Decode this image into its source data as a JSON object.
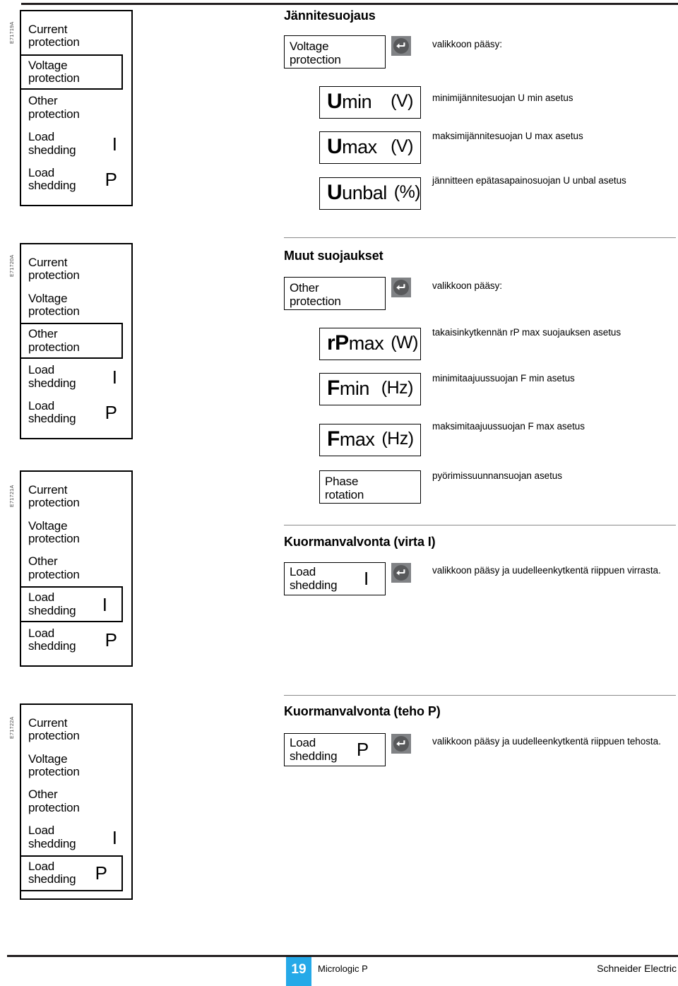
{
  "page": {
    "footer": {
      "page_number": "19",
      "document": "Micrologic P",
      "brand": "Schneider Electric",
      "accent_color": "#25a9e8"
    }
  },
  "menu_items": {
    "current_protection": "Current\nprotection",
    "voltage_protection": "Voltage\nprotection",
    "other_protection": "Other\nprotection",
    "load_shedding": "Load\nshedding",
    "sym_i": "I",
    "sym_p": "P"
  },
  "sections": [
    {
      "ref_code": "E71719A",
      "title": "Jännitesuojaus",
      "selected_menu_index": 1,
      "namebox": {
        "label": "Voltage\nprotection",
        "symbol": ""
      },
      "access_desc": "valikkoon pääsy:",
      "rows": [
        {
          "sym_bold": "U",
          "sym_rest": "min",
          "unit": "(V)",
          "desc": "minimijännitesuojan U min asetus"
        },
        {
          "sym_bold": "U",
          "sym_rest": "max",
          "unit": "(V)",
          "desc": "maksimijännitesuojan U max asetus"
        },
        {
          "sym_bold": "U",
          "sym_rest": "unbal",
          "unit": "(%)",
          "desc": "jännitteen epätasapainosuojan U unbal asetus"
        }
      ]
    },
    {
      "ref_code": "E71720A",
      "title": "Muut suojaukset",
      "selected_menu_index": 2,
      "namebox": {
        "label": "Other\nprotection",
        "symbol": ""
      },
      "access_desc": "valikkoon pääsy:",
      "rows": [
        {
          "sym_bold": "rP",
          "sym_rest": "max",
          "unit": "(W)",
          "desc": "takaisinkytkennän rP max suojauksen asetus"
        },
        {
          "sym_bold": "F",
          "sym_rest": "min",
          "unit": "(Hz)",
          "desc": "minimitaajuussuojan F min asetus"
        },
        {
          "sym_bold": "F",
          "sym_rest": "max",
          "unit": "(Hz)",
          "desc": "maksimitaajuussuojan F max asetus"
        }
      ],
      "phase_rotation": {
        "label": "Phase\nrotation",
        "desc": "pyörimissuunnansuojan asetus"
      }
    },
    {
      "ref_code": "E71721A",
      "title": "Kuormanvalvonta (virta I)",
      "selected_menu_index": 3,
      "namebox": {
        "label": "Load\nshedding",
        "symbol": "I"
      },
      "access_desc": "valikkoon pääsy ja uudelleenkytkentä riippuen virrasta."
    },
    {
      "ref_code": "E71722A",
      "title": "Kuormanvalvonta (teho P)",
      "selected_menu_index": 4,
      "namebox": {
        "label": "Load\nshedding",
        "symbol": "P"
      },
      "access_desc": "valikkoon pääsy ja uudelleenkytkentä riippuen tehosta."
    }
  ]
}
